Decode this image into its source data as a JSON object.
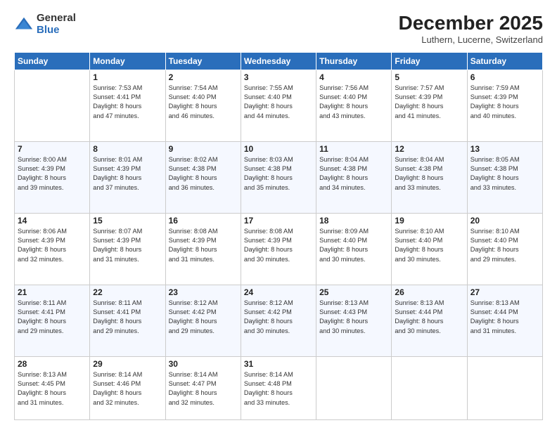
{
  "logo": {
    "general": "General",
    "blue": "Blue"
  },
  "header": {
    "month": "December 2025",
    "location": "Luthern, Lucerne, Switzerland"
  },
  "weekdays": [
    "Sunday",
    "Monday",
    "Tuesday",
    "Wednesday",
    "Thursday",
    "Friday",
    "Saturday"
  ],
  "weeks": [
    [
      {
        "day": "",
        "info": ""
      },
      {
        "day": "1",
        "info": "Sunrise: 7:53 AM\nSunset: 4:41 PM\nDaylight: 8 hours\nand 47 minutes."
      },
      {
        "day": "2",
        "info": "Sunrise: 7:54 AM\nSunset: 4:40 PM\nDaylight: 8 hours\nand 46 minutes."
      },
      {
        "day": "3",
        "info": "Sunrise: 7:55 AM\nSunset: 4:40 PM\nDaylight: 8 hours\nand 44 minutes."
      },
      {
        "day": "4",
        "info": "Sunrise: 7:56 AM\nSunset: 4:40 PM\nDaylight: 8 hours\nand 43 minutes."
      },
      {
        "day": "5",
        "info": "Sunrise: 7:57 AM\nSunset: 4:39 PM\nDaylight: 8 hours\nand 41 minutes."
      },
      {
        "day": "6",
        "info": "Sunrise: 7:59 AM\nSunset: 4:39 PM\nDaylight: 8 hours\nand 40 minutes."
      }
    ],
    [
      {
        "day": "7",
        "info": "Sunrise: 8:00 AM\nSunset: 4:39 PM\nDaylight: 8 hours\nand 39 minutes."
      },
      {
        "day": "8",
        "info": "Sunrise: 8:01 AM\nSunset: 4:39 PM\nDaylight: 8 hours\nand 37 minutes."
      },
      {
        "day": "9",
        "info": "Sunrise: 8:02 AM\nSunset: 4:38 PM\nDaylight: 8 hours\nand 36 minutes."
      },
      {
        "day": "10",
        "info": "Sunrise: 8:03 AM\nSunset: 4:38 PM\nDaylight: 8 hours\nand 35 minutes."
      },
      {
        "day": "11",
        "info": "Sunrise: 8:04 AM\nSunset: 4:38 PM\nDaylight: 8 hours\nand 34 minutes."
      },
      {
        "day": "12",
        "info": "Sunrise: 8:04 AM\nSunset: 4:38 PM\nDaylight: 8 hours\nand 33 minutes."
      },
      {
        "day": "13",
        "info": "Sunrise: 8:05 AM\nSunset: 4:38 PM\nDaylight: 8 hours\nand 33 minutes."
      }
    ],
    [
      {
        "day": "14",
        "info": "Sunrise: 8:06 AM\nSunset: 4:39 PM\nDaylight: 8 hours\nand 32 minutes."
      },
      {
        "day": "15",
        "info": "Sunrise: 8:07 AM\nSunset: 4:39 PM\nDaylight: 8 hours\nand 31 minutes."
      },
      {
        "day": "16",
        "info": "Sunrise: 8:08 AM\nSunset: 4:39 PM\nDaylight: 8 hours\nand 31 minutes."
      },
      {
        "day": "17",
        "info": "Sunrise: 8:08 AM\nSunset: 4:39 PM\nDaylight: 8 hours\nand 30 minutes."
      },
      {
        "day": "18",
        "info": "Sunrise: 8:09 AM\nSunset: 4:40 PM\nDaylight: 8 hours\nand 30 minutes."
      },
      {
        "day": "19",
        "info": "Sunrise: 8:10 AM\nSunset: 4:40 PM\nDaylight: 8 hours\nand 30 minutes."
      },
      {
        "day": "20",
        "info": "Sunrise: 8:10 AM\nSunset: 4:40 PM\nDaylight: 8 hours\nand 29 minutes."
      }
    ],
    [
      {
        "day": "21",
        "info": "Sunrise: 8:11 AM\nSunset: 4:41 PM\nDaylight: 8 hours\nand 29 minutes."
      },
      {
        "day": "22",
        "info": "Sunrise: 8:11 AM\nSunset: 4:41 PM\nDaylight: 8 hours\nand 29 minutes."
      },
      {
        "day": "23",
        "info": "Sunrise: 8:12 AM\nSunset: 4:42 PM\nDaylight: 8 hours\nand 29 minutes."
      },
      {
        "day": "24",
        "info": "Sunrise: 8:12 AM\nSunset: 4:42 PM\nDaylight: 8 hours\nand 30 minutes."
      },
      {
        "day": "25",
        "info": "Sunrise: 8:13 AM\nSunset: 4:43 PM\nDaylight: 8 hours\nand 30 minutes."
      },
      {
        "day": "26",
        "info": "Sunrise: 8:13 AM\nSunset: 4:44 PM\nDaylight: 8 hours\nand 30 minutes."
      },
      {
        "day": "27",
        "info": "Sunrise: 8:13 AM\nSunset: 4:44 PM\nDaylight: 8 hours\nand 31 minutes."
      }
    ],
    [
      {
        "day": "28",
        "info": "Sunrise: 8:13 AM\nSunset: 4:45 PM\nDaylight: 8 hours\nand 31 minutes."
      },
      {
        "day": "29",
        "info": "Sunrise: 8:14 AM\nSunset: 4:46 PM\nDaylight: 8 hours\nand 32 minutes."
      },
      {
        "day": "30",
        "info": "Sunrise: 8:14 AM\nSunset: 4:47 PM\nDaylight: 8 hours\nand 32 minutes."
      },
      {
        "day": "31",
        "info": "Sunrise: 8:14 AM\nSunset: 4:48 PM\nDaylight: 8 hours\nand 33 minutes."
      },
      {
        "day": "",
        "info": ""
      },
      {
        "day": "",
        "info": ""
      },
      {
        "day": "",
        "info": ""
      }
    ]
  ]
}
